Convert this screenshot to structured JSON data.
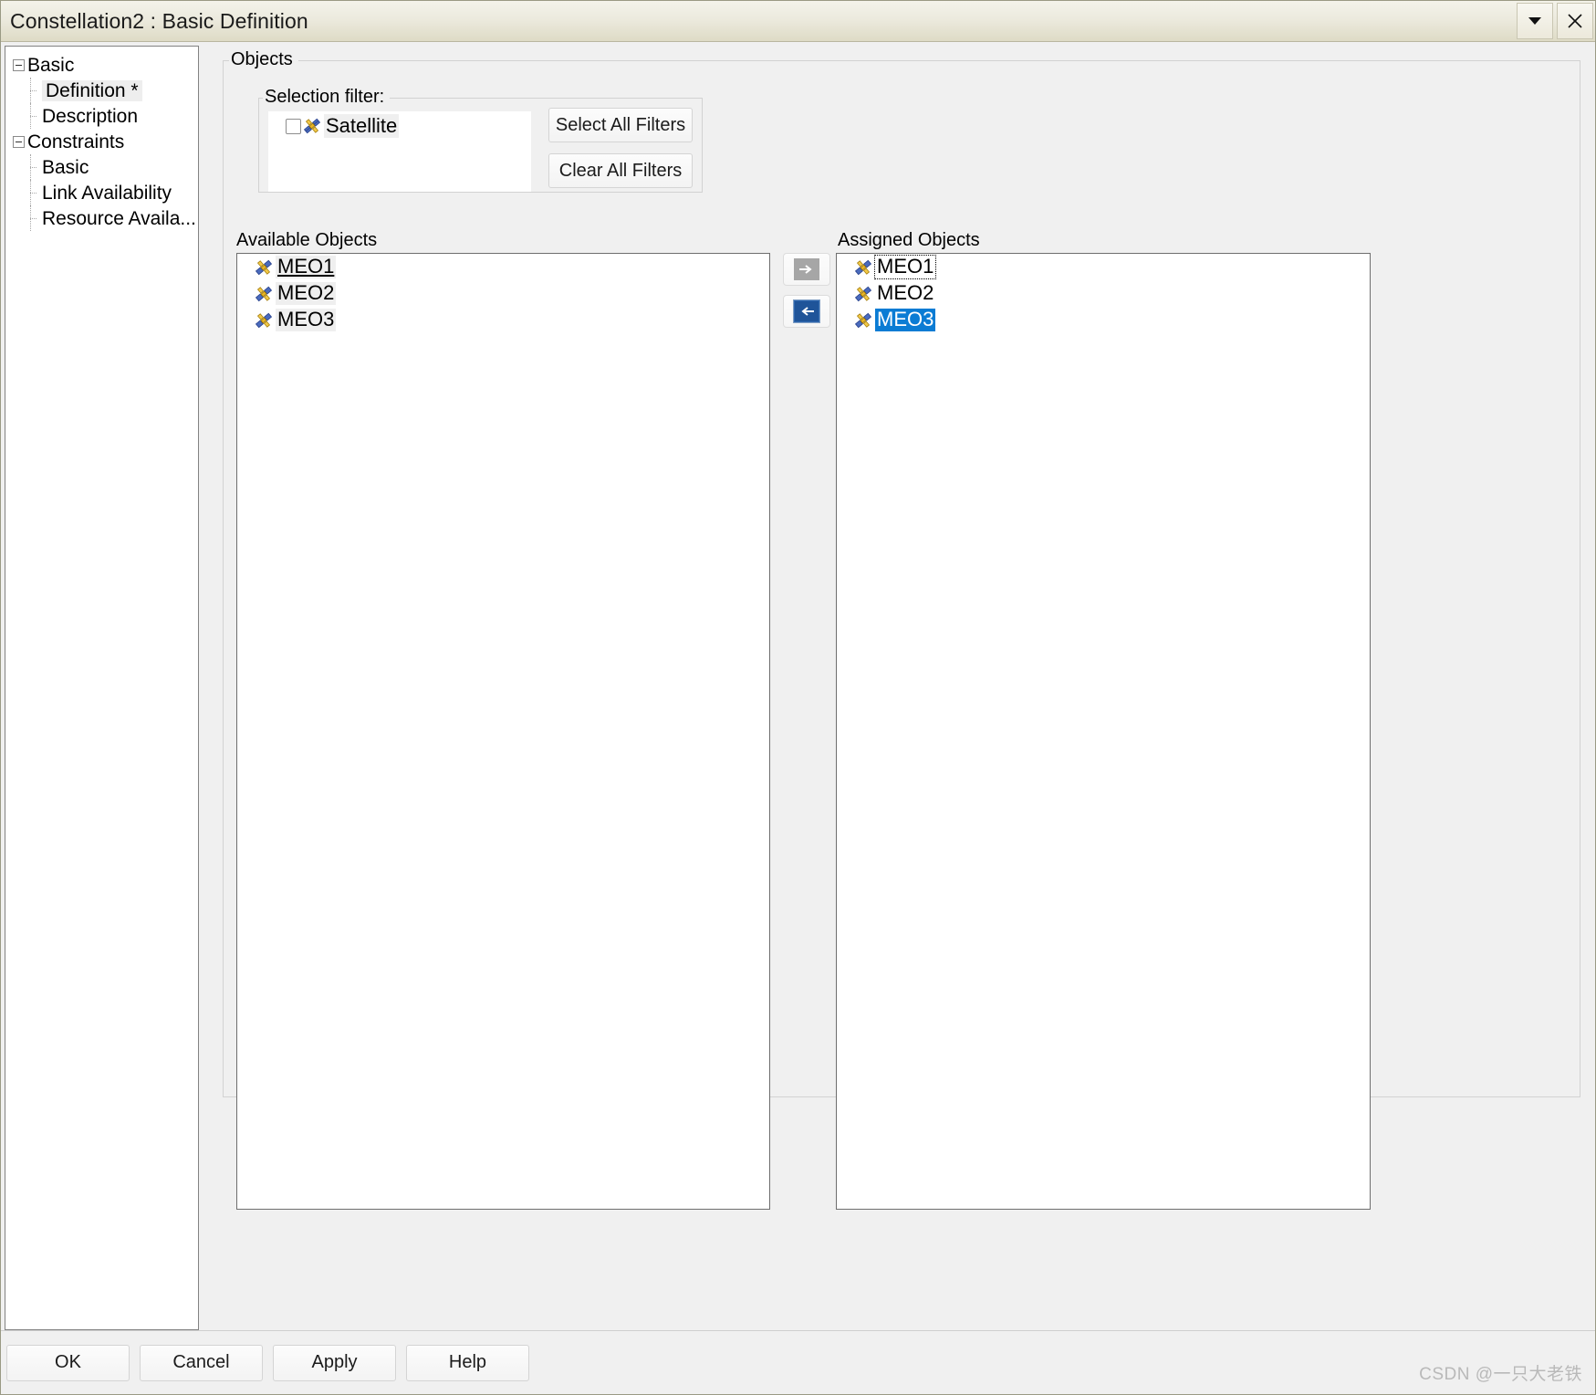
{
  "window": {
    "title": "Constellation2 : Basic Definition",
    "dropdown_icon": "chevron-down-icon",
    "close_icon": "close-icon"
  },
  "sidebar": {
    "nodes": [
      {
        "label": "Basic",
        "type": "group",
        "expanded": true,
        "selected": false
      },
      {
        "label": "Definition *",
        "type": "child",
        "selected": true
      },
      {
        "label": "Description",
        "type": "child",
        "selected": false
      },
      {
        "label": "Constraints",
        "type": "group",
        "expanded": true,
        "selected": false
      },
      {
        "label": "Basic",
        "type": "child",
        "selected": false
      },
      {
        "label": "Link Availability",
        "type": "child",
        "selected": false
      },
      {
        "label": "Resource Availa...",
        "type": "child",
        "selected": false
      }
    ]
  },
  "objects": {
    "legend": "Objects",
    "selection_filter": {
      "legend": "Selection filter:",
      "items": [
        {
          "label": "Satellite",
          "checked": false,
          "icon": "satellite-icon",
          "highlighted": true
        }
      ],
      "select_all_label": "Select All Filters",
      "clear_all_label": "Clear All Filters"
    },
    "available": {
      "heading": "Available Objects",
      "items": [
        {
          "label": "MEO1",
          "icon": "satellite-icon",
          "state": "hover-underline"
        },
        {
          "label": "MEO2",
          "icon": "satellite-icon",
          "state": "highlight"
        },
        {
          "label": "MEO3",
          "icon": "satellite-icon",
          "state": "highlight"
        }
      ]
    },
    "assigned": {
      "heading": "Assigned Objects",
      "items": [
        {
          "label": "MEO1",
          "icon": "satellite-icon",
          "state": "focus"
        },
        {
          "label": "MEO2",
          "icon": "satellite-icon",
          "state": "normal"
        },
        {
          "label": "MEO3",
          "icon": "satellite-icon",
          "state": "selected"
        }
      ]
    },
    "transfer": {
      "assign_icon": "arrow-right-icon",
      "assign_enabled": false,
      "unassign_icon": "arrow-left-icon",
      "unassign_enabled": true
    }
  },
  "footer": {
    "buttons": [
      "OK",
      "Cancel",
      "Apply",
      "Help"
    ],
    "watermark": "CSDN @一只大老铁"
  },
  "colors": {
    "selection_blue": "#0b7cd4",
    "arrow_enabled_blue": "#1f5499",
    "arrow_disabled_gray": "#a6a6a6",
    "highlight_gray": "#efefef",
    "panel_bg": "#f0f0f0",
    "titlebar_bg": "#eceade"
  }
}
